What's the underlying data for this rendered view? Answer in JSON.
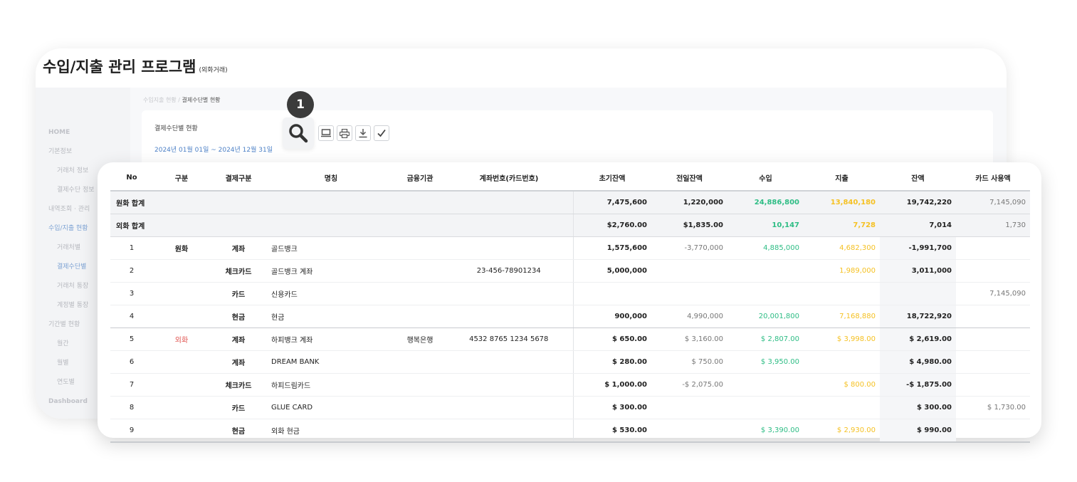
{
  "app": {
    "title": "수입/지출 관리 프로그램",
    "subtitle": "(외화거래)"
  },
  "sidebar": {
    "items": [
      {
        "label": "HOME"
      },
      {
        "label": "기본정보"
      },
      {
        "label": "거래처 정보"
      },
      {
        "label": "결제수단 정보"
      },
      {
        "label": "내역조회 · 관리"
      },
      {
        "label": "수입/지출 현황"
      },
      {
        "label": "거래처별"
      },
      {
        "label": "결제수단별"
      },
      {
        "label": "거래처 통장"
      },
      {
        "label": "계정별 통장"
      },
      {
        "label": "기간별 현황"
      },
      {
        "label": "월간"
      },
      {
        "label": "월별"
      },
      {
        "label": "연도별"
      },
      {
        "label": "Dashboard"
      }
    ]
  },
  "breadcrumb": {
    "parent": "수입지출 현황",
    "separator": " / ",
    "current": "결제수단별 현황"
  },
  "panel": {
    "title": "결제수단별 현황",
    "date_range": "2024년 01월 01일 ~ 2024년 12월 31일"
  },
  "badge": {
    "number": "1"
  },
  "icons": {
    "search": "search-icon",
    "monitor": "monitor-icon",
    "print": "print-icon",
    "download": "download-icon",
    "check": "check-icon"
  },
  "table": {
    "headers": {
      "no": "No",
      "gubun": "구분",
      "method": "결제구분",
      "name": "명칭",
      "bank": "금융기관",
      "account": "계좌번호(카드번호)",
      "initial": "초기잔액",
      "prev": "전일잔액",
      "income": "수입",
      "expense": "지출",
      "balance": "잔액",
      "card_used": "카드 사용액"
    },
    "summary": [
      {
        "label": "원화 합계",
        "initial": "7,475,600",
        "prev": "1,220,000",
        "income": "24,886,800",
        "expense": "13,840,180",
        "balance": "19,742,220",
        "card_used": "7,145,090"
      },
      {
        "label": "외화 합계",
        "initial": "$2,760.00",
        "prev": "$1,835.00",
        "income": "10,147",
        "expense": "7,728",
        "balance": "7,014",
        "card_used": "1,730"
      }
    ],
    "rows": [
      {
        "no": "1",
        "gubun": "원화",
        "method": "계좌",
        "name": "골드뱅크",
        "bank": "",
        "account": "",
        "initial": "1,575,600",
        "prev": "-3,770,000",
        "income": "4,885,000",
        "expense": "4,682,300",
        "balance": "-1,991,700",
        "card_used": ""
      },
      {
        "no": "2",
        "gubun": "",
        "method": "체크카드",
        "name": "골드뱅크 계좌",
        "bank": "",
        "account": "23-456-78901234",
        "initial": "5,000,000",
        "prev": "",
        "income": "",
        "expense": "1,989,000",
        "balance": "3,011,000",
        "card_used": ""
      },
      {
        "no": "3",
        "gubun": "",
        "method": "카드",
        "name": "신용카드",
        "bank": "",
        "account": "",
        "initial": "",
        "prev": "",
        "income": "",
        "expense": "",
        "balance": "",
        "card_used": "7,145,090"
      },
      {
        "no": "4",
        "gubun": "",
        "method": "현금",
        "name": "현금",
        "bank": "",
        "account": "",
        "initial": "900,000",
        "prev": "4,990,000",
        "income": "20,001,800",
        "expense": "7,168,880",
        "balance": "18,722,920",
        "card_used": ""
      },
      {
        "no": "5",
        "gubun": "외화",
        "method": "계좌",
        "name": "하피뱅크 계좌",
        "bank": "행복은행",
        "account": "4532 8765 1234 5678",
        "initial": "$ 650.00",
        "prev": "$ 3,160.00",
        "income": "$ 2,807.00",
        "expense": "$ 3,998.00",
        "balance": "$ 2,619.00",
        "card_used": ""
      },
      {
        "no": "6",
        "gubun": "",
        "method": "계좌",
        "name": "DREAM BANK",
        "bank": "",
        "account": "",
        "initial": "$ 280.00",
        "prev": "$ 750.00",
        "income": "$ 3,950.00",
        "expense": "",
        "balance": "$ 4,980.00",
        "card_used": ""
      },
      {
        "no": "7",
        "gubun": "",
        "method": "체크카드",
        "name": "하피드림카드",
        "bank": "",
        "account": "",
        "initial": "$ 1,000.00",
        "prev": "-$ 2,075.00",
        "income": "",
        "expense": "$ 800.00",
        "balance": "-$ 1,875.00",
        "card_used": ""
      },
      {
        "no": "8",
        "gubun": "",
        "method": "카드",
        "name": "GLUE CARD",
        "bank": "",
        "account": "",
        "initial": "$ 300.00",
        "prev": "",
        "income": "",
        "expense": "",
        "balance": "$ 300.00",
        "card_used": "$ 1,730.00"
      },
      {
        "no": "9",
        "gubun": "",
        "method": "현금",
        "name": "외화 현금",
        "bank": "",
        "account": "",
        "initial": "$ 530.00",
        "prev": "",
        "income": "$ 3,390.00",
        "expense": "$ 2,930.00",
        "balance": "$ 990.00",
        "card_used": ""
      }
    ]
  },
  "colors": {
    "income": "#2ebd85",
    "expense": "#f5c123",
    "foreign_label": "#e0534f",
    "link": "#4c80c6"
  }
}
